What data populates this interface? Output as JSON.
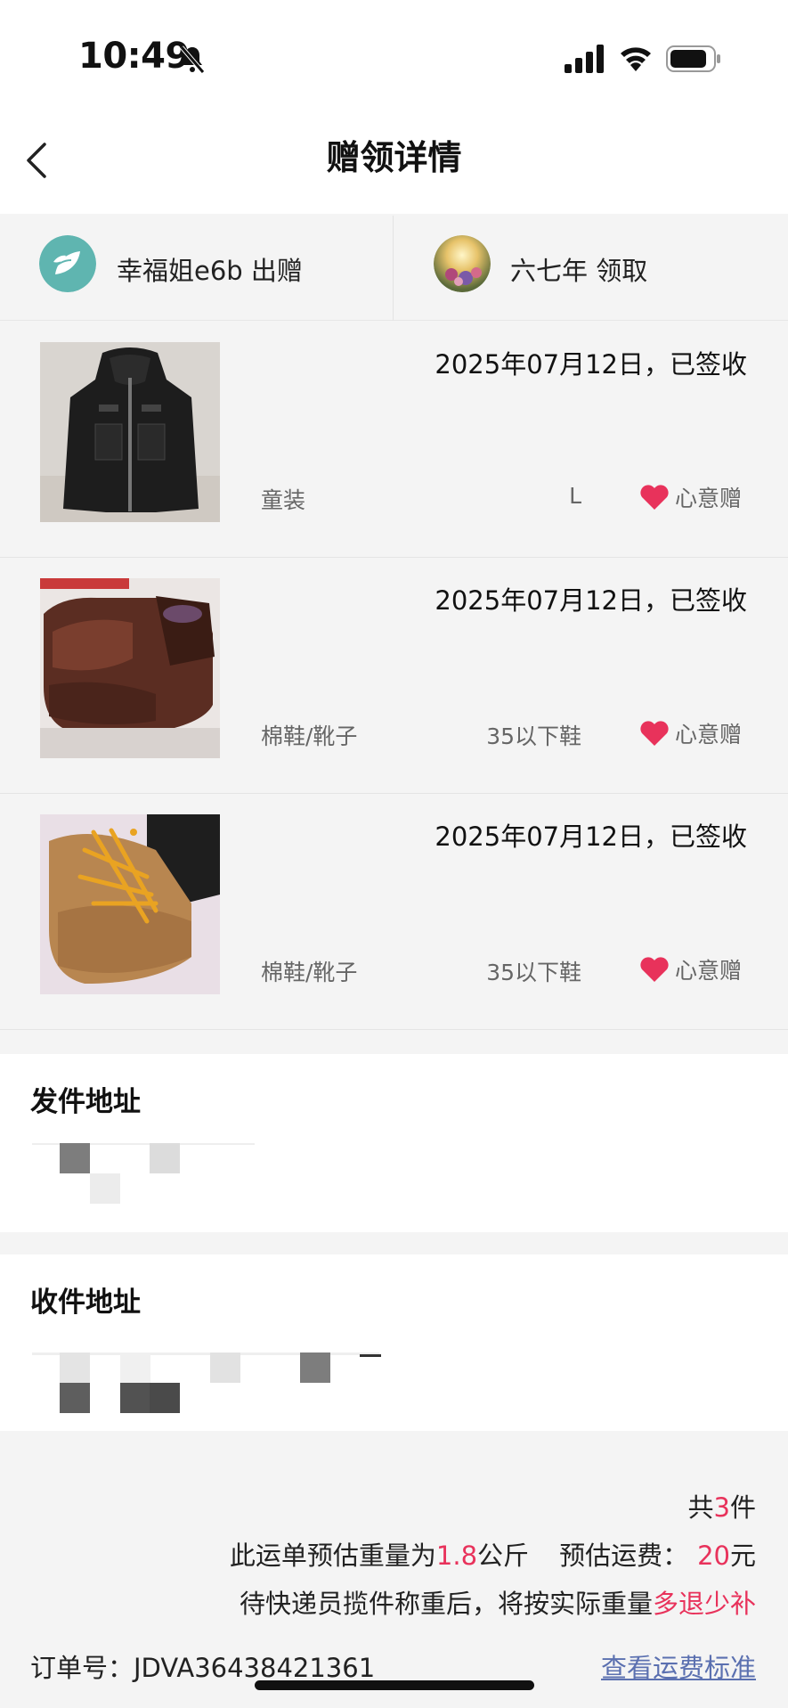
{
  "status_bar": {
    "time": "10:49"
  },
  "nav": {
    "title": "赠领详情"
  },
  "parties": {
    "giver": {
      "name": "幸福姐e6b 出赠"
    },
    "receiver": {
      "name": "六七年 领取"
    }
  },
  "items": [
    {
      "date_status": "2025年07月12日，已签收",
      "category": "童装",
      "size": "L",
      "gift_type": "心意赠"
    },
    {
      "date_status": "2025年07月12日，已签收",
      "category": "棉鞋/靴子",
      "size": "35以下鞋",
      "gift_type": "心意赠"
    },
    {
      "date_status": "2025年07月12日，已签收",
      "category": "棉鞋/靴子",
      "size": "35以下鞋",
      "gift_type": "心意赠"
    }
  ],
  "sender_address": {
    "title": "发件地址"
  },
  "receiver_address": {
    "title": "收件地址"
  },
  "summary": {
    "total_prefix": "共",
    "total_count": "3",
    "total_suffix": "件",
    "weight_prefix": "此运单预估重量为",
    "weight_value": "1.8",
    "weight_unit": "公斤",
    "fee_label": "预估运费：",
    "fee_value": "20",
    "fee_unit": "元",
    "note_prefix": "待快递员揽件称重后，将按实际重量",
    "note_highlight": "多退少补",
    "order_label": "订单号：JDVA36438421361",
    "freight_link": "查看运费标准"
  },
  "colors": {
    "accent": "#e8325b",
    "link": "#5b70b0",
    "heart": "#e8325b"
  }
}
